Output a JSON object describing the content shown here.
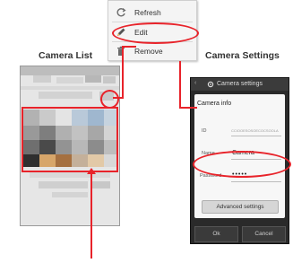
{
  "context_menu": {
    "items": [
      {
        "label": "Refresh",
        "icon": "refresh-icon"
      },
      {
        "label": "Edit",
        "icon": "pencil-icon"
      },
      {
        "label": "Remove",
        "icon": "trash-icon"
      }
    ]
  },
  "camera_list": {
    "title": "Camera List"
  },
  "camera_settings": {
    "title": "Camera Settings",
    "app_bar_title": "Camera settings",
    "section_title": "Camera info",
    "fields": [
      {
        "label": "ID",
        "value": "CCIOOESOSOECOCSOOLA"
      },
      {
        "label": "Name",
        "value": "Camera"
      },
      {
        "label": "Password",
        "value": "•••••"
      }
    ],
    "advanced_button": "Advanced settings",
    "ok_button": "Ok",
    "cancel_button": "Cancel"
  },
  "colors": {
    "highlight": "#e8232a"
  }
}
